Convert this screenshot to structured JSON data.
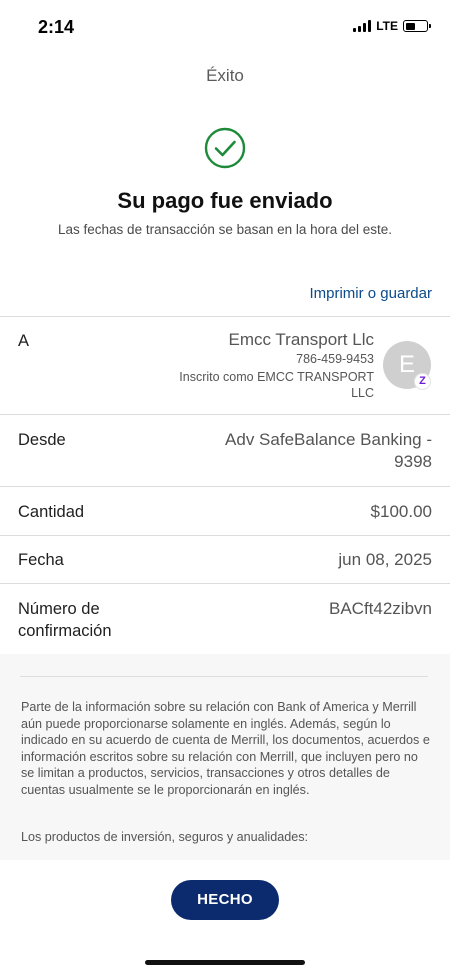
{
  "status_bar": {
    "time": "2:14",
    "network": "LTE",
    "battery_level": 0.45
  },
  "header": {
    "title": "Éxito"
  },
  "confirmation": {
    "headline": "Su pago fue enviado",
    "subline": "Las fechas de transacción se basan en la hora del este.",
    "print_label": "Imprimir o guardar"
  },
  "details": {
    "to": {
      "label": "A",
      "name": "Emcc Transport Llc",
      "phone": "786-459-9453",
      "enrolled": "Inscrito como EMCC TRANSPORT LLC",
      "avatar_initial": "E",
      "badge": "Z"
    },
    "from": {
      "label": "Desde",
      "value_line1": "Adv SafeBalance Banking -",
      "value_line2": "9398"
    },
    "amount": {
      "label": "Cantidad",
      "value": "$100.00"
    },
    "date": {
      "label": "Fecha",
      "value": "jun 08, 2025"
    },
    "confirmation_number": {
      "label_line1": "Número de",
      "label_line2": "confirmación",
      "value": "BACft42zibvn"
    }
  },
  "disclosure": {
    "text": "Parte de la información sobre su relación con Bank of America y Merrill aún puede proporcionarse solamente en inglés. Además, según lo indicado en su acuerdo de cuenta de Merrill, los documentos, acuerdos e información escritos sobre su relación con Merrill, que incluyen pero no se limitan a productos, servicios, transacciones y otros detalles de cuentas usualmente se le proporcionarán en inglés.",
    "subheading": "Los productos de inversión, seguros y anualidades:"
  },
  "actions": {
    "done_label": "HECHO"
  },
  "colors": {
    "accent": "#0c2b6e",
    "link": "#0b4a8b",
    "success": "#1e8a3a",
    "zelle": "#6d1ed4"
  }
}
